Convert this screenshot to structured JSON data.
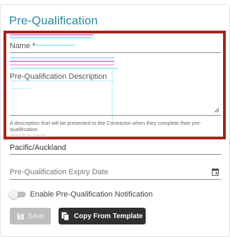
{
  "page": {
    "title": "Pre-Qualification"
  },
  "form": {
    "name_label": "Name *",
    "description_label": "Pre-Qualification Description",
    "description_helper": "A description that will be presented to the Contractor when they complete their pre-qualification.",
    "description_helper_faded": "Search by name...",
    "timezone_value": "Pacific/Auckland",
    "expiry_label": "Pre-Qualification Expiry Date",
    "notification_toggle_label": "Enable Pre-Qualification Notification",
    "notification_enabled": false
  },
  "buttons": {
    "save_label": "Save",
    "copy_label": "Copy From Template"
  },
  "icons": {
    "calendar": "calendar-icon",
    "save": "floppy-disk-icon",
    "copy": "copy-icon",
    "resize": "resize-grip-icon"
  },
  "colors": {
    "title": "#2a8c9d",
    "highlight_border": "#a4241d",
    "copy_button": "#2f2f2f",
    "save_button_disabled": "#bdbdbd"
  }
}
